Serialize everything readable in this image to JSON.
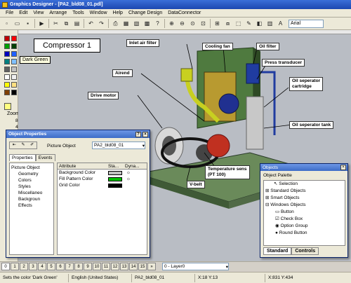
{
  "window": {
    "title": "Graphics Designer - [PA2_bld08_01.pdl]"
  },
  "menu": [
    "File",
    "Edit",
    "View",
    "Arrange",
    "Tools",
    "Window",
    "Help",
    "Change Design",
    "DataConnector"
  ],
  "toolbar": {
    "font_value": "Arial"
  },
  "palette": {
    "colors": [
      "#c00000",
      "#ff0000",
      "#00a000",
      "#004000",
      "#0000c0",
      "#2060ff",
      "#008080",
      "#80c0ff",
      "#606060",
      "#c0c0c0",
      "#ffffff",
      "#f0f0f0",
      "#ffff00",
      "#ffe080",
      "#804000",
      "#000000"
    ],
    "tooltip": "Dark Green",
    "zoom_label": "Zoom",
    "zoom_values": [
      "800",
      "400"
    ]
  },
  "diagram": {
    "title": "Compressor 1",
    "callouts": {
      "inlet_air_filter": "Inlet air filter",
      "cooling_fan": "Cooling fan",
      "oil_filter": "Oil filter",
      "press_transducer": "Press transducer",
      "airend": "Airend",
      "oil_seperator_cartridge_1": "Oil seperator",
      "oil_seperator_cartridge_2": "cartridge",
      "drive_motor": "Drive motor",
      "oil_seperator_tank": "Oil seperator tank",
      "temperature_sensor_1": "Temperature sens",
      "temperature_sensor_2": "(PT 100)",
      "v_belt": "V-belt"
    }
  },
  "props": {
    "title": "Object Properties",
    "object_label": "Picture Object",
    "object_value": "PA2_bld08_01",
    "tabs": [
      "Properties",
      "Events"
    ],
    "tree": [
      "Picture Object",
      "Geometry",
      "Colors",
      "Styles",
      "Miscellaneo",
      "Backgroun",
      "Effects"
    ],
    "columns": [
      "Attribute",
      "Sta...",
      "Dyna..."
    ],
    "rows": [
      {
        "attr": "Background Color",
        "color": "#c0c0c0"
      },
      {
        "attr": "Fill Pattern Color",
        "color": "#00c000"
      },
      {
        "attr": "Grid Color",
        "color": "#000000"
      }
    ]
  },
  "objects": {
    "title": "Objects",
    "palette_label": "Object Palette",
    "items": [
      "Selection",
      "Standard Objects",
      "Smart Objects",
      "Windows Objects",
      "Button",
      "Check Box",
      "Option Group",
      "Round Button"
    ],
    "tabs": [
      "Standard",
      "Controls"
    ]
  },
  "pagetabs": [
    "0",
    "1",
    "2",
    "3",
    "4",
    "5",
    "6",
    "7",
    "8",
    "9",
    "10",
    "11",
    "12",
    "13",
    "14",
    "15"
  ],
  "layer": "0 - Layer0",
  "status": {
    "message": "Sets the color 'Dark Green'",
    "language": "English (United States)",
    "file": "PA2_bld08_01",
    "pos": "X:18 Y:13",
    "size": "X:831 Y:434"
  }
}
